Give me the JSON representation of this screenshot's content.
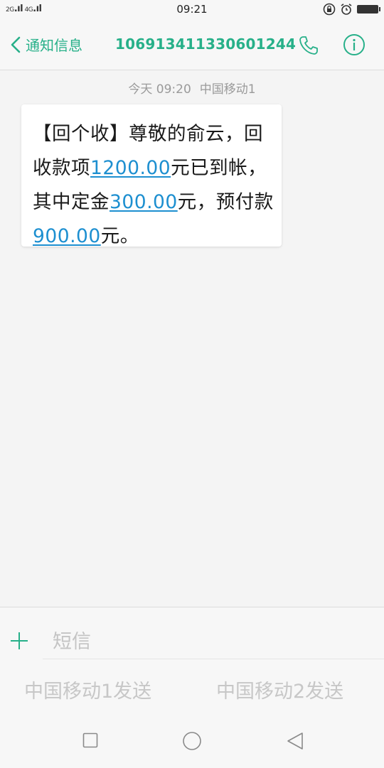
{
  "status_bar": {
    "sim1_network": "2G",
    "sim2_network": "4G",
    "time": "09:21",
    "icons": [
      "signal-icon",
      "lock-rotation-icon",
      "alarm-icon",
      "battery-icon"
    ]
  },
  "header": {
    "back_label": "通知信息",
    "phone_number": "106913411330601244",
    "accent_color": "#27b089"
  },
  "conversation": {
    "meta_day_time": "今天 09:20",
    "meta_carrier": "中国移动1",
    "message": {
      "part1": "【回个收】尊敬的俞云，回收款项",
      "amount_total": "1200.00",
      "part2": "元已到帐，其中定金",
      "amount_deposit": "300.00",
      "part3": "元，预付款",
      "amount_prepay": "900.00",
      "part4": "元。"
    },
    "link_color": "#1d8fd0"
  },
  "composer": {
    "placeholder": "短信",
    "send_sim1": "中国移动1发送",
    "send_sim2": "中国移动2发送"
  }
}
